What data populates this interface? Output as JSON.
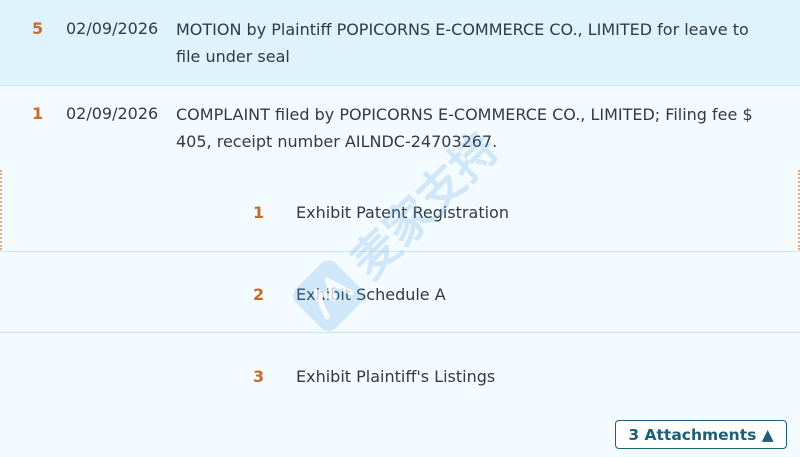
{
  "docket_entries": [
    {
      "number": "5",
      "date": "02/09/2026",
      "description": "MOTION by Plaintiff POPICORNS E-COMMERCE CO., LIMITED for leave to file under seal"
    },
    {
      "number": "1",
      "date": "02/09/2026",
      "description": "COMPLAINT filed by POPICORNS E-COMMERCE CO., LIMITED; Filing fee $ 405, receipt number AILNDC-24703267."
    }
  ],
  "attachments": [
    {
      "number": "1",
      "label": "Exhibit Patent Registration"
    },
    {
      "number": "2",
      "label": "Exhibit Schedule A"
    },
    {
      "number": "3",
      "label": "Exhibit Plaintiff's Listings"
    }
  ],
  "attachments_toggle": {
    "label": "3 Attachments ▲"
  },
  "watermark": {
    "text": "麦家支持",
    "icon": "maijia-logo-icon"
  },
  "colors": {
    "row_highlight": "#def3fb",
    "row_background": "#f3fbfe",
    "number_accent": "#c76b2e",
    "button_border": "#1b5f78",
    "watermark": "#5aa7e2"
  }
}
